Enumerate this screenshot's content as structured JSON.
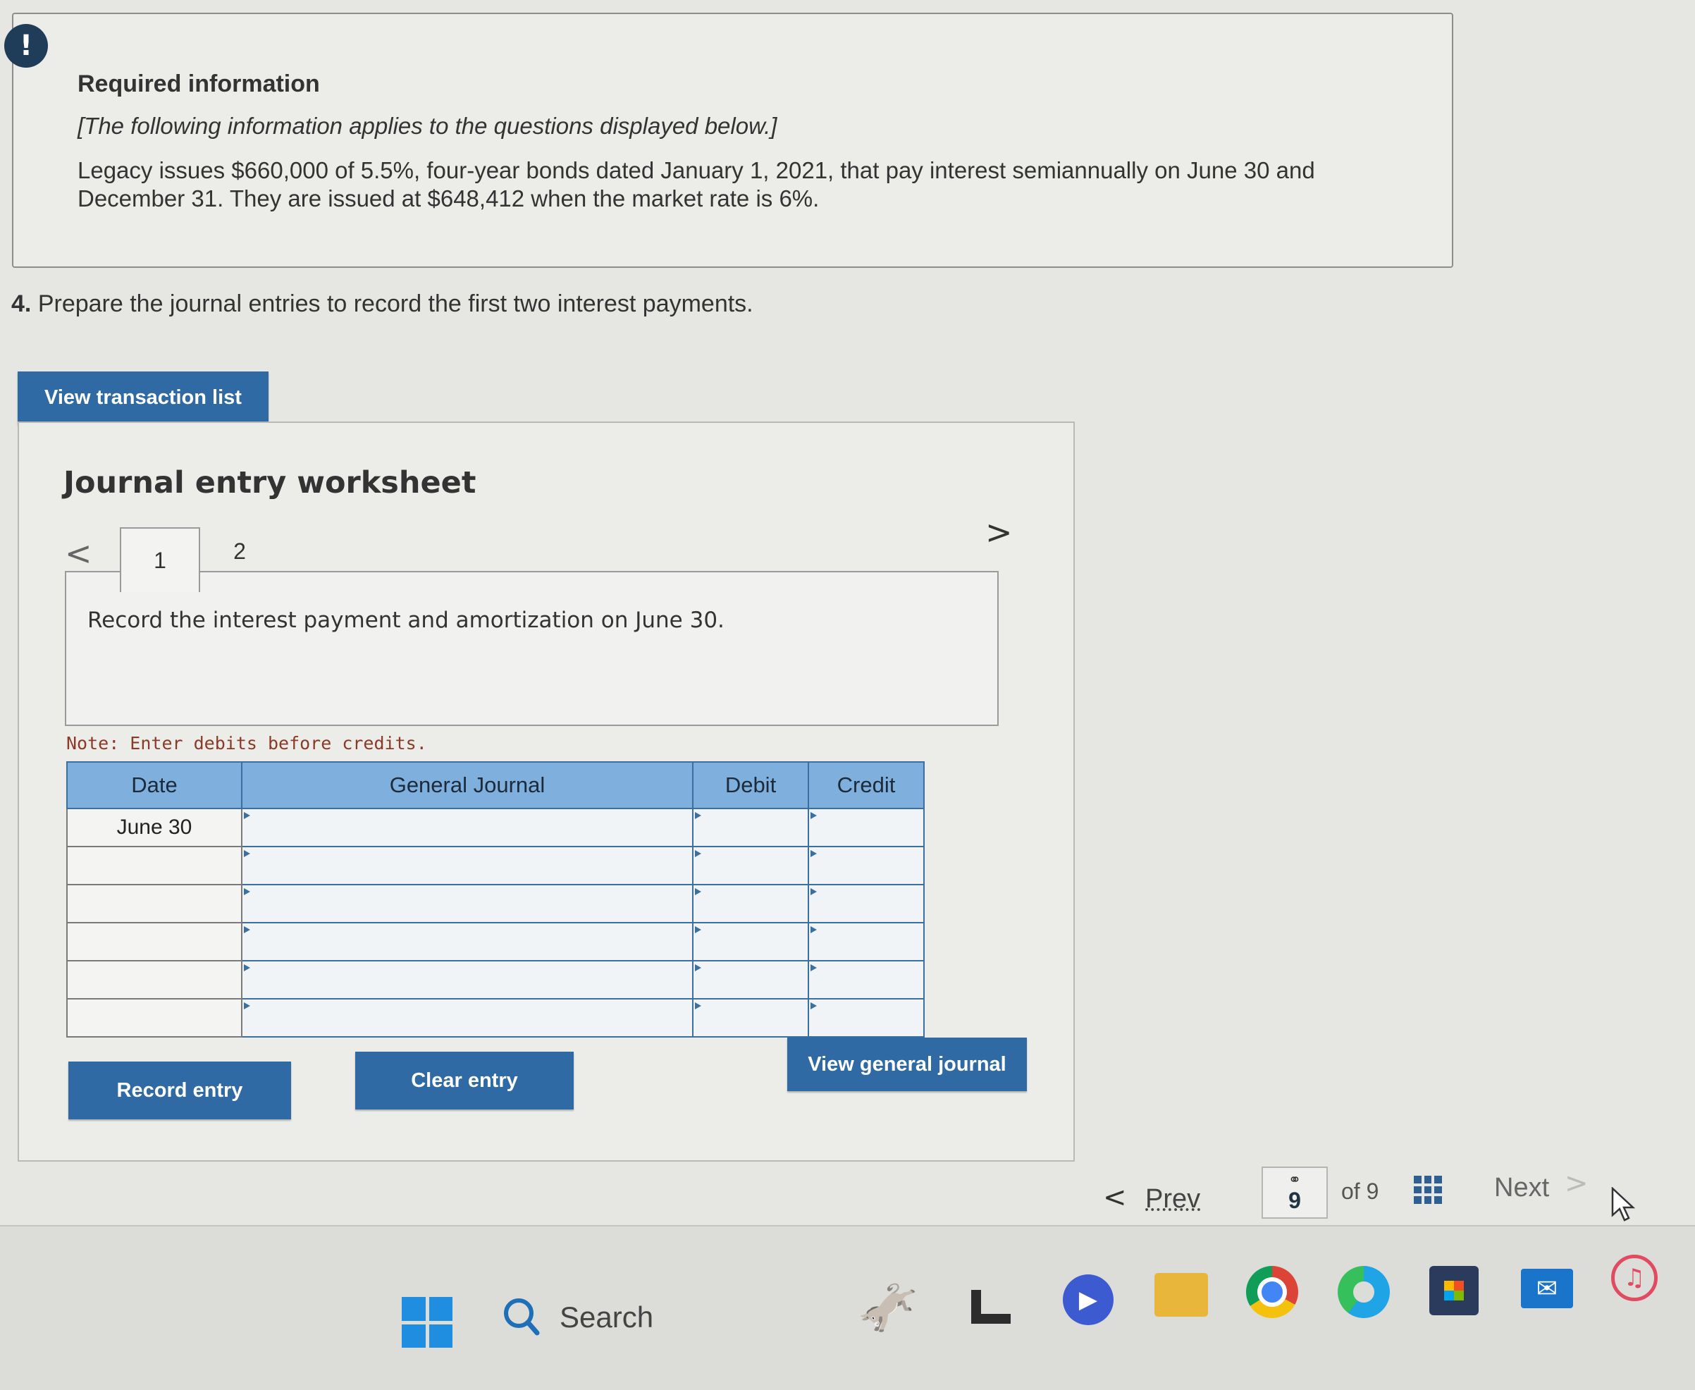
{
  "alert": {
    "icon": "exclamation-icon",
    "symbol": "!"
  },
  "required_info": {
    "title": "Required information",
    "subtitle": "[The following information applies to the questions displayed below.]",
    "body": "Legacy issues $660,000 of 5.5%, four-year bonds dated January 1, 2021, that pay interest semiannually on June 30 and December 31. They are issued at $648,412 when the market rate is 6%."
  },
  "question": {
    "number": "4.",
    "text": "Prepare the journal entries to record the first two interest payments."
  },
  "buttons": {
    "view_transaction_list": "View transaction list",
    "record_entry": "Record entry",
    "clear_entry": "Clear entry",
    "view_general_journal": "View general journal"
  },
  "worksheet": {
    "title": "Journal entry worksheet",
    "tabs": [
      {
        "label": "1",
        "active": true
      },
      {
        "label": "2",
        "active": false
      }
    ],
    "prev_symbol": "<",
    "next_symbol": ">",
    "instruction": "Record the interest payment and amortization on June 30.",
    "note": "Note: Enter debits before credits."
  },
  "journal_table": {
    "headers": {
      "date": "Date",
      "general_journal": "General Journal",
      "debit": "Debit",
      "credit": "Credit"
    },
    "rows": [
      {
        "date": "June 30",
        "account": "",
        "debit": "",
        "credit": ""
      },
      {
        "date": "",
        "account": "",
        "debit": "",
        "credit": ""
      },
      {
        "date": "",
        "account": "",
        "debit": "",
        "credit": ""
      },
      {
        "date": "",
        "account": "",
        "debit": "",
        "credit": ""
      },
      {
        "date": "",
        "account": "",
        "debit": "",
        "credit": ""
      },
      {
        "date": "",
        "account": "",
        "debit": "",
        "credit": ""
      }
    ]
  },
  "pagination": {
    "prev_label": "Prev",
    "prev_symbol": "<",
    "current_page": "9",
    "of_label": "of 9",
    "next_label": "Next",
    "next_symbol": ">",
    "link_symbol": "⚭"
  },
  "taskbar": {
    "search_label": "Search",
    "icons": [
      "windows-start-icon",
      "search-icon",
      "donkey-widget-icon",
      "l-app-icon",
      "meet-app-icon",
      "file-explorer-icon",
      "chrome-icon",
      "edge-icon",
      "store-icon",
      "mail-icon",
      "music-icon"
    ]
  },
  "colors": {
    "button_blue": "#2f6aa4",
    "table_header": "#7fb0dd",
    "note_text": "#8a3a26",
    "alert_badge": "#1f3c58"
  }
}
